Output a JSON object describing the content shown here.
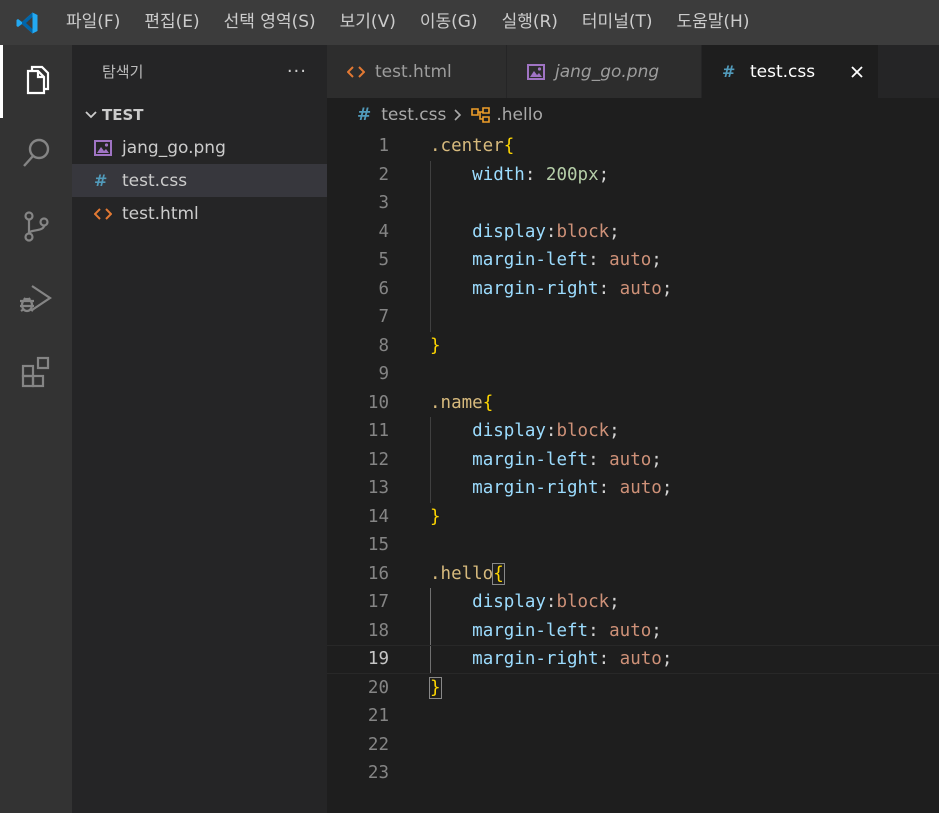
{
  "titlebar": {
    "logo_icon": "vscode-logo-icon",
    "menu": [
      "파일(F)",
      "편집(E)",
      "선택 영역(S)",
      "보기(V)",
      "이동(G)",
      "실행(R)",
      "터미널(T)",
      "도움말(H)"
    ]
  },
  "activitybar": {
    "items": [
      {
        "name": "explorer",
        "icon": "files-icon",
        "active": true
      },
      {
        "name": "search",
        "icon": "search-icon",
        "active": false
      },
      {
        "name": "source-control",
        "icon": "source-control-icon",
        "active": false
      },
      {
        "name": "run-debug",
        "icon": "run-debug-icon",
        "active": false
      },
      {
        "name": "extensions",
        "icon": "extensions-icon",
        "active": false
      }
    ]
  },
  "sidebar": {
    "title": "탐색기",
    "more": "···",
    "folder": "TEST",
    "files": [
      {
        "label": "jang_go.png",
        "icon": "image-file-icon",
        "selected": false
      },
      {
        "label": "test.css",
        "icon": "css-file-icon",
        "selected": true
      },
      {
        "label": "test.html",
        "icon": "html-file-icon",
        "selected": false
      }
    ]
  },
  "tabs": [
    {
      "label": "test.html",
      "icon": "html-file-icon",
      "italic": false,
      "active": false
    },
    {
      "label": "jang_go.png",
      "icon": "image-file-icon",
      "italic": true,
      "active": false
    },
    {
      "label": "test.css",
      "icon": "css-file-icon",
      "italic": false,
      "active": true
    }
  ],
  "breadcrumb": {
    "file": "test.css",
    "symbol": ".hello"
  },
  "editor": {
    "current_line": 19,
    "lines": [
      [
        {
          "t": ".center",
          "c": "sel"
        },
        {
          "t": "{",
          "c": "brace"
        }
      ],
      [
        {
          "t": "    ",
          "c": ""
        },
        {
          "t": "width",
          "c": "prop"
        },
        {
          "t": ": ",
          "c": "punct"
        },
        {
          "t": "200px",
          "c": "num"
        },
        {
          "t": ";",
          "c": "punct"
        }
      ],
      [],
      [
        {
          "t": "    ",
          "c": ""
        },
        {
          "t": "display",
          "c": "prop"
        },
        {
          "t": ":",
          "c": "punct"
        },
        {
          "t": "block",
          "c": "val"
        },
        {
          "t": ";",
          "c": "punct"
        }
      ],
      [
        {
          "t": "    ",
          "c": ""
        },
        {
          "t": "margin-left",
          "c": "prop"
        },
        {
          "t": ": ",
          "c": "punct"
        },
        {
          "t": "auto",
          "c": "val"
        },
        {
          "t": ";",
          "c": "punct"
        }
      ],
      [
        {
          "t": "    ",
          "c": ""
        },
        {
          "t": "margin-right",
          "c": "prop"
        },
        {
          "t": ": ",
          "c": "punct"
        },
        {
          "t": "auto",
          "c": "val"
        },
        {
          "t": ";",
          "c": "punct"
        }
      ],
      [],
      [
        {
          "t": "}",
          "c": "brace"
        }
      ],
      [],
      [
        {
          "t": ".name",
          "c": "sel"
        },
        {
          "t": "{",
          "c": "brace"
        }
      ],
      [
        {
          "t": "    ",
          "c": ""
        },
        {
          "t": "display",
          "c": "prop"
        },
        {
          "t": ":",
          "c": "punct"
        },
        {
          "t": "block",
          "c": "val"
        },
        {
          "t": ";",
          "c": "punct"
        }
      ],
      [
        {
          "t": "    ",
          "c": ""
        },
        {
          "t": "margin-left",
          "c": "prop"
        },
        {
          "t": ": ",
          "c": "punct"
        },
        {
          "t": "auto",
          "c": "val"
        },
        {
          "t": ";",
          "c": "punct"
        }
      ],
      [
        {
          "t": "    ",
          "c": ""
        },
        {
          "t": "margin-right",
          "c": "prop"
        },
        {
          "t": ": ",
          "c": "punct"
        },
        {
          "t": "auto",
          "c": "val"
        },
        {
          "t": ";",
          "c": "punct"
        }
      ],
      [
        {
          "t": "}",
          "c": "brace"
        }
      ],
      [],
      [
        {
          "t": ".hello",
          "c": "sel"
        },
        {
          "t": "{",
          "c": "brace",
          "match": true
        }
      ],
      [
        {
          "t": "    ",
          "c": ""
        },
        {
          "t": "display",
          "c": "prop"
        },
        {
          "t": ":",
          "c": "punct"
        },
        {
          "t": "block",
          "c": "val"
        },
        {
          "t": ";",
          "c": "punct"
        }
      ],
      [
        {
          "t": "    ",
          "c": ""
        },
        {
          "t": "margin-left",
          "c": "prop"
        },
        {
          "t": ": ",
          "c": "punct"
        },
        {
          "t": "auto",
          "c": "val"
        },
        {
          "t": ";",
          "c": "punct"
        }
      ],
      [
        {
          "t": "    ",
          "c": ""
        },
        {
          "t": "margin-right",
          "c": "prop"
        },
        {
          "t": ": ",
          "c": "punct"
        },
        {
          "t": "auto",
          "c": "val"
        },
        {
          "t": ";",
          "c": "punct"
        }
      ],
      [
        {
          "t": "}",
          "c": "brace",
          "match": true
        }
      ],
      [],
      [],
      []
    ]
  },
  "colors": {
    "accent": "#007acc",
    "selector": "#d7ba7d",
    "brace": "#ffd700",
    "property": "#9cdcfe",
    "value": "#ce9178",
    "number": "#b5cea8"
  }
}
